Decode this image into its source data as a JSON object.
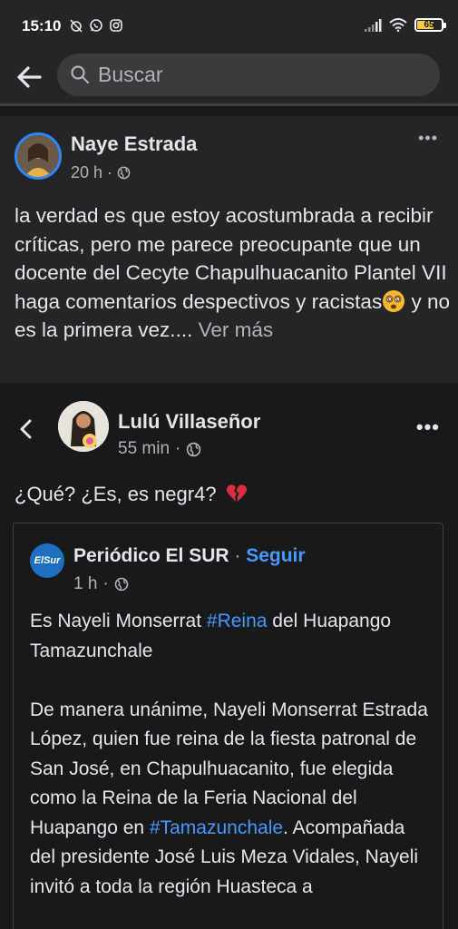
{
  "status_bar": {
    "time": "15:10",
    "battery": "65",
    "battery_level": 0.65,
    "icons": [
      "muted-alarm-icon",
      "whatsapp-icon",
      "instagram-icon",
      "signal-icon",
      "wifi-icon",
      "battery-icon"
    ]
  },
  "header": {
    "search_placeholder": "Buscar"
  },
  "post": {
    "author": "Naye Estrada",
    "time": "20 h",
    "privacy": "public",
    "text": "la verdad es que estoy acostumbrada a recibir críticas, pero me parece preocupante que un docente del Cecyte Chapulhuacanito Plantel VII haga comentarios despectivos y racistas",
    "text_after_emoji": " y no es la primera vez.",
    "ellipsis": "...",
    "see_more": " Ver más"
  },
  "shared_post": {
    "author": "Lulú Villaseñor",
    "time": "55 min",
    "text": "¿Qué? ¿Es, es negr4?",
    "quoted": {
      "page_name": "Periódico El SUR",
      "page_logo_text": "ElSur",
      "separator": " · ",
      "follow": "Seguir",
      "time": "1 h",
      "p1_before": "Es Nayeli Monserrat ",
      "p1_hashtag": "#Reina",
      "p1_after": " del Huapango Tamazunchale",
      "p2_before": "De manera unánime, Nayeli Monserrat Estrada López, quien fue reina de la fiesta patronal de San José, en Chapulhuacanito, fue elegida como la Reina de la Feria Nacional del Huapango en ",
      "p2_hashtag": "#Tamazunchale",
      "p2_after": ". Acompañada del presidente José Luis Meza Vidales, Nayeli invitó a toda la región Huasteca a"
    }
  },
  "colors": {
    "background": "#242526",
    "link_blue": "#4599ff",
    "secondary_text": "#b0b3b8",
    "primary_text": "#e4e6eb"
  }
}
